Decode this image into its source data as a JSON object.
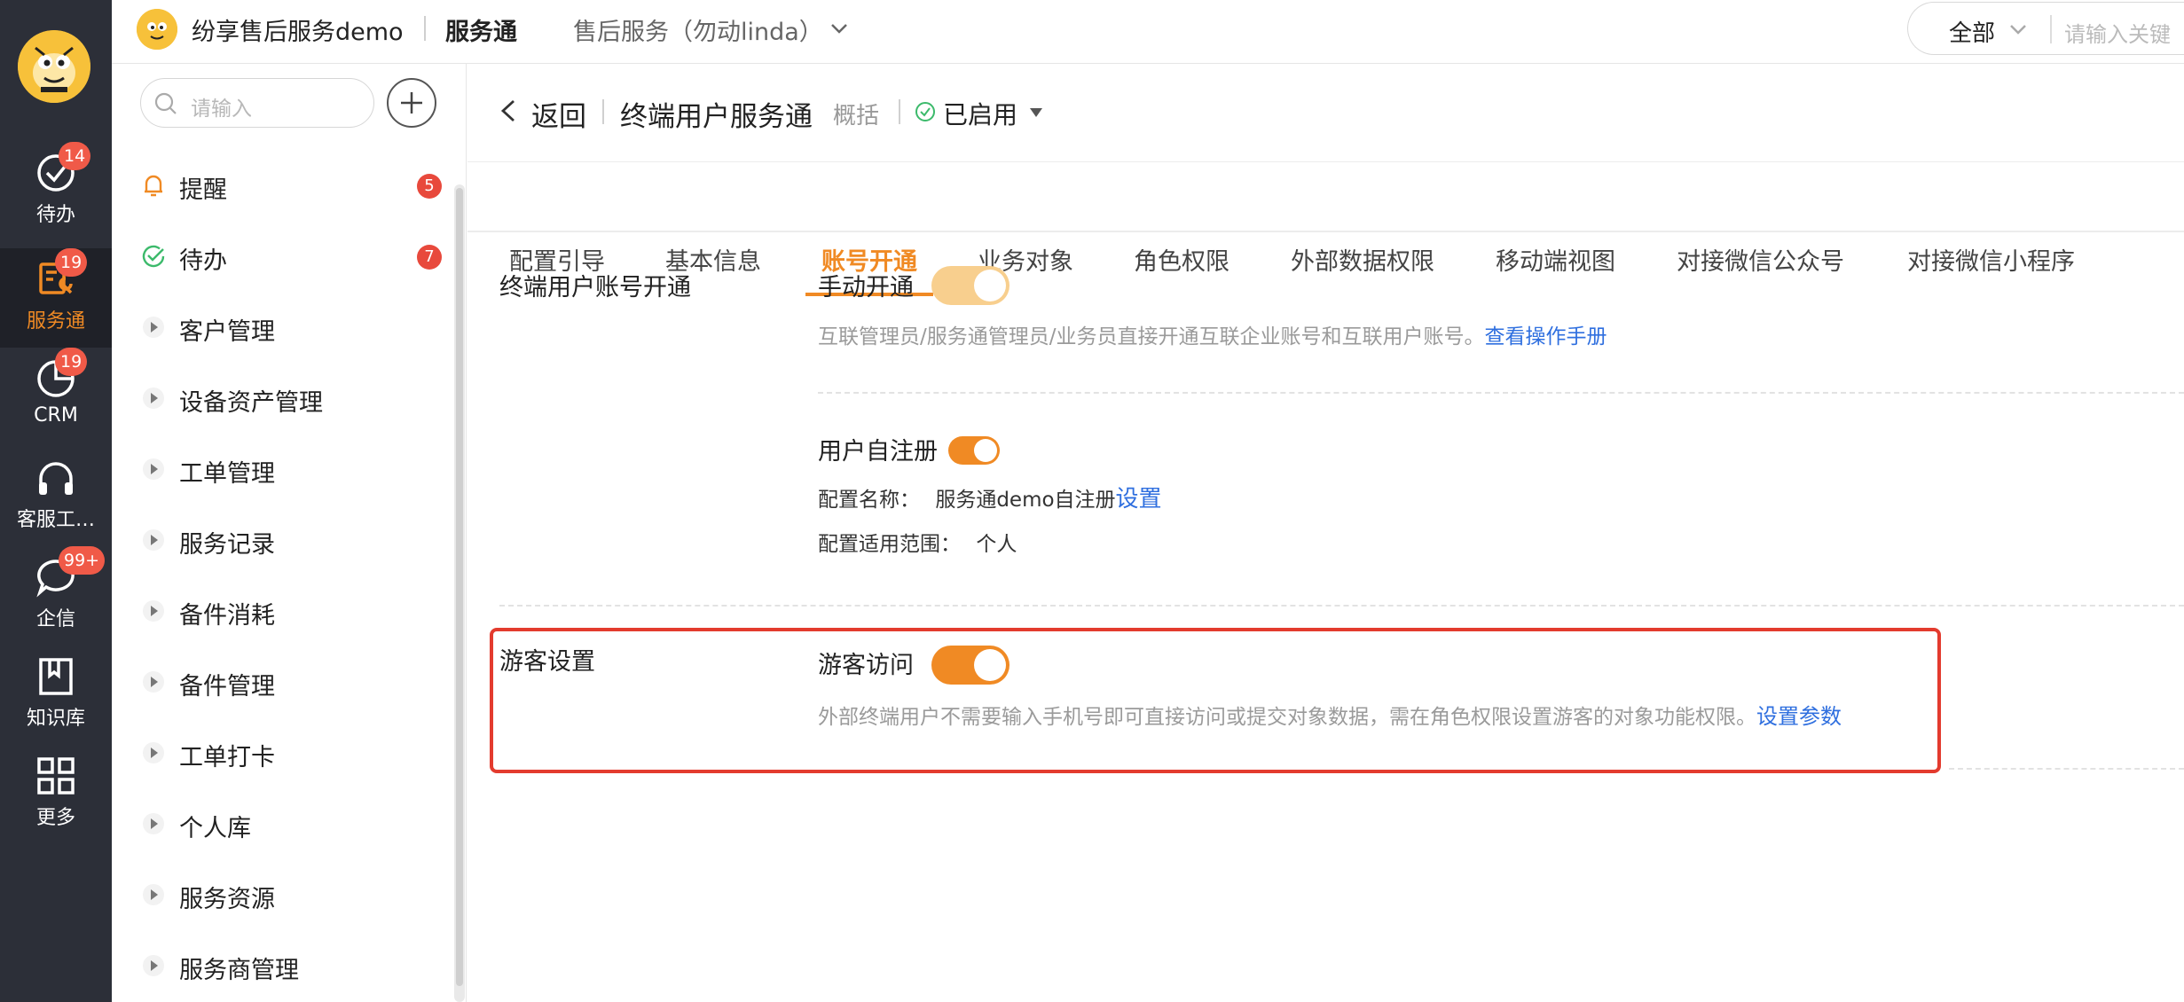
{
  "rail": {
    "items": [
      {
        "label": "待办",
        "badge": "14",
        "icon": "check-circle-icon"
      },
      {
        "label": "服务通",
        "badge": "19",
        "icon": "service-tools-icon"
      },
      {
        "label": "CRM",
        "badge": "19",
        "icon": "pie-chart-icon"
      },
      {
        "label": "客服工…",
        "badge": "",
        "icon": "headset-icon"
      },
      {
        "label": "企信",
        "badge": "99+",
        "icon": "chat-bubble-icon"
      },
      {
        "label": "知识库",
        "badge": "",
        "icon": "book-icon"
      },
      {
        "label": "更多",
        "badge": "",
        "icon": "grid-icon"
      }
    ]
  },
  "topbar": {
    "company": "纷享售后服务demo",
    "app": "服务通",
    "scope": "售后服务（勿动linda）",
    "search_scope": "全部",
    "search_placeholder": "请输入关键"
  },
  "sidenav": {
    "search_placeholder": "请输入",
    "items": [
      {
        "label": "提醒",
        "count": "5",
        "icon": "bell-icon"
      },
      {
        "label": "待办",
        "count": "7",
        "icon": "check-circle-icon"
      },
      {
        "label": "客户管理",
        "icon": "caret-right-icon"
      },
      {
        "label": "设备资产管理",
        "icon": "caret-right-icon"
      },
      {
        "label": "工单管理",
        "icon": "caret-right-icon"
      },
      {
        "label": "服务记录",
        "icon": "caret-right-icon"
      },
      {
        "label": "备件消耗",
        "icon": "caret-right-icon"
      },
      {
        "label": "备件管理",
        "icon": "caret-right-icon"
      },
      {
        "label": "工单打卡",
        "icon": "caret-right-icon"
      },
      {
        "label": "个人库",
        "icon": "caret-right-icon"
      },
      {
        "label": "服务资源",
        "icon": "caret-right-icon"
      },
      {
        "label": "服务商管理",
        "icon": "caret-right-icon"
      }
    ]
  },
  "header": {
    "back": "返回",
    "title": "终端用户服务通",
    "subtitle": "概括",
    "status": "已启用"
  },
  "tabs": [
    "配置引导",
    "基本信息",
    "账号开通",
    "业务对象",
    "角色权限",
    "外部数据权限",
    "移动端视图",
    "对接微信公众号",
    "对接微信小程序"
  ],
  "active_tab": "账号开通",
  "account": {
    "section_label": "终端用户账号开通",
    "manual": {
      "title": "手动开通",
      "enabled": true,
      "desc": "互联管理员/服务通管理员/业务员直接开通互联企业账号和互联用户账号。",
      "link": "查看操作手册"
    },
    "self_register": {
      "title": "用户自注册",
      "enabled": true,
      "config_name_label": "配置名称：",
      "config_name_value": "服务通demo自注册",
      "config_link": "设置",
      "scope_label": "配置适用范围：",
      "scope_value": "个人"
    }
  },
  "guest": {
    "section_label": "游客设置",
    "title": "游客访问",
    "enabled": true,
    "desc": "外部终端用户不需要输入手机号即可直接访问或提交对象数据，需在角色权限设置游客的对象功能权限。",
    "link": "设置参数"
  },
  "colors": {
    "accent": "#f08a24",
    "toggle_on": "#f08a24",
    "toggle_disabled_on": "#f8cf8e",
    "link": "#2f6fdf",
    "highlight": "#e33b2e",
    "rail_bg": "#2c2f38"
  }
}
